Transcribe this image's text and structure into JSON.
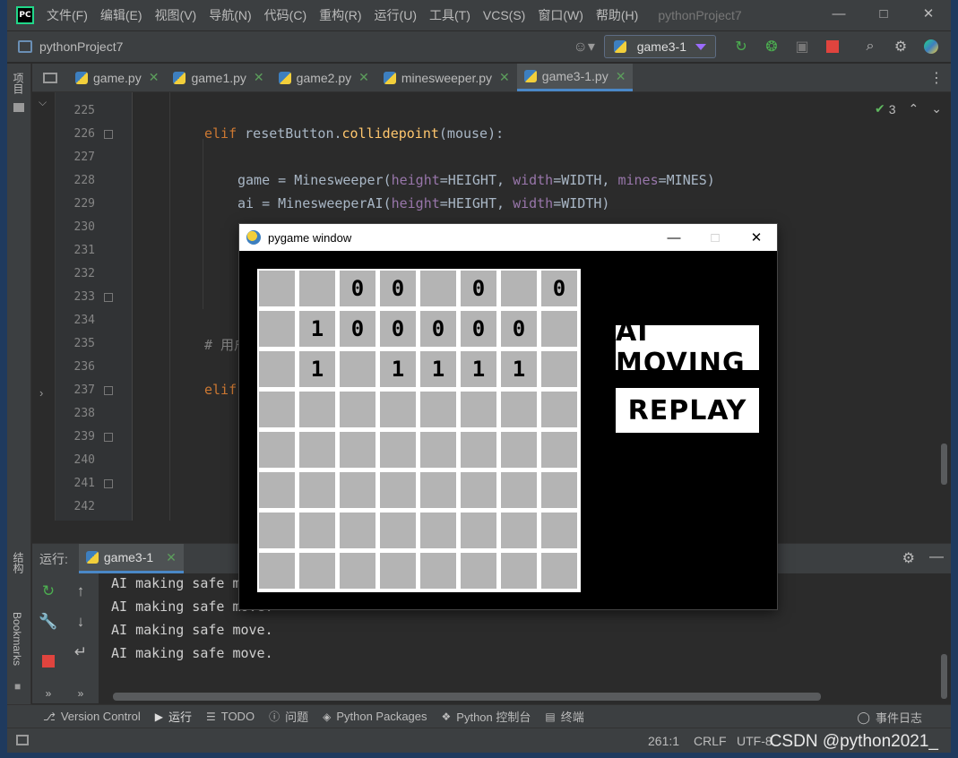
{
  "menubar": {
    "items": [
      "文件(F)",
      "编辑(E)",
      "视图(V)",
      "导航(N)",
      "代码(C)",
      "重构(R)",
      "运行(U)",
      "工具(T)",
      "VCS(S)",
      "窗口(W)",
      "帮助(H)"
    ],
    "window_title": "pythonProject7",
    "logo_text": "PC"
  },
  "navbar": {
    "project": "pythonProject7",
    "run_config": "game3-1"
  },
  "left_strip": {
    "project_label": "项目",
    "structure_label": "结构",
    "bookmarks_label": "Bookmarks"
  },
  "tabs": [
    {
      "label": "game.py",
      "active": false
    },
    {
      "label": "game1.py",
      "active": false
    },
    {
      "label": "game2.py",
      "active": false
    },
    {
      "label": "minesweeper.py",
      "active": false
    },
    {
      "label": "game3-1.py",
      "active": true
    }
  ],
  "editor": {
    "inspection_count": "3",
    "line_numbers": [
      "225",
      "226",
      "227",
      "228",
      "229",
      "230",
      "231",
      "232",
      "233",
      "234",
      "235",
      "236",
      "237",
      "238",
      "239",
      "240",
      "241",
      "242"
    ],
    "code": {
      "l226_kw": "elif",
      "l226_rest1": " resetButton.",
      "l226_fn": "collidepoint",
      "l226_rest2": "(mouse):",
      "l228_a": "game = ",
      "l228_cls": "Minesweeper",
      "l228_p1": "height",
      "l228_v1": "=HEIGHT, ",
      "l228_p2": "width",
      "l228_v2": "=WIDTH, ",
      "l228_p3": "mines",
      "l228_v3": "=MINES)",
      "l229_a": "ai = ",
      "l229_cls": "MinesweeperAI",
      "l229_p1": "height",
      "l229_v1": "=HEIGHT, ",
      "l229_p2": "width",
      "l229_v2": "=WIDTH)",
      "l235_cmt": "# 用户",
      "l237_kw": "elif"
    }
  },
  "run_panel": {
    "label": "运行:",
    "tab": "game3-1",
    "console": [
      "AI making safe move.",
      "AI making safe move.",
      "AI making safe move.",
      "AI making safe move."
    ]
  },
  "bottom_tools": [
    {
      "label": "Version Control",
      "icon": "branch-icon",
      "active": false
    },
    {
      "label": "运行",
      "icon": "run-icon",
      "active": true
    },
    {
      "label": "TODO",
      "icon": "list-icon",
      "active": false
    },
    {
      "label": "问题",
      "icon": "problems-icon",
      "active": false
    },
    {
      "label": "Python Packages",
      "icon": "packages-icon",
      "active": false
    },
    {
      "label": "Python 控制台",
      "icon": "console-icon",
      "active": false
    },
    {
      "label": "终端",
      "icon": "terminal-icon",
      "active": false
    }
  ],
  "event_log": "事件日志",
  "status": {
    "position": "261:1",
    "line_sep": "CRLF",
    "encoding": "UTF-8",
    "watermark": "CSDN @python2021_"
  },
  "pygame": {
    "title": "pygame window",
    "rows": [
      [
        "",
        "",
        "0",
        "0",
        "",
        "0",
        "",
        "0"
      ],
      [
        "",
        "1",
        "0",
        "0",
        "0",
        "0",
        "0",
        ""
      ],
      [
        "",
        "1",
        "",
        "1",
        "1",
        "1",
        "1",
        ""
      ],
      [
        "",
        "",
        "",
        "",
        "",
        "",
        "",
        ""
      ],
      [
        "",
        "",
        "",
        "",
        "",
        "",
        "",
        ""
      ],
      [
        "",
        "",
        "",
        "",
        "",
        "",
        "",
        ""
      ],
      [
        "",
        "",
        "",
        "",
        "",
        "",
        "",
        ""
      ],
      [
        "",
        "",
        "",
        "",
        "",
        "",
        "",
        ""
      ]
    ],
    "ai_button": "AI MOVING",
    "replay_button": "REPLAY"
  },
  "colors": {
    "accent": "#4a88c7",
    "cell": "#b4b4b4",
    "keyword": "#cc7832",
    "function": "#ffc66d",
    "param": "#9876aa"
  }
}
